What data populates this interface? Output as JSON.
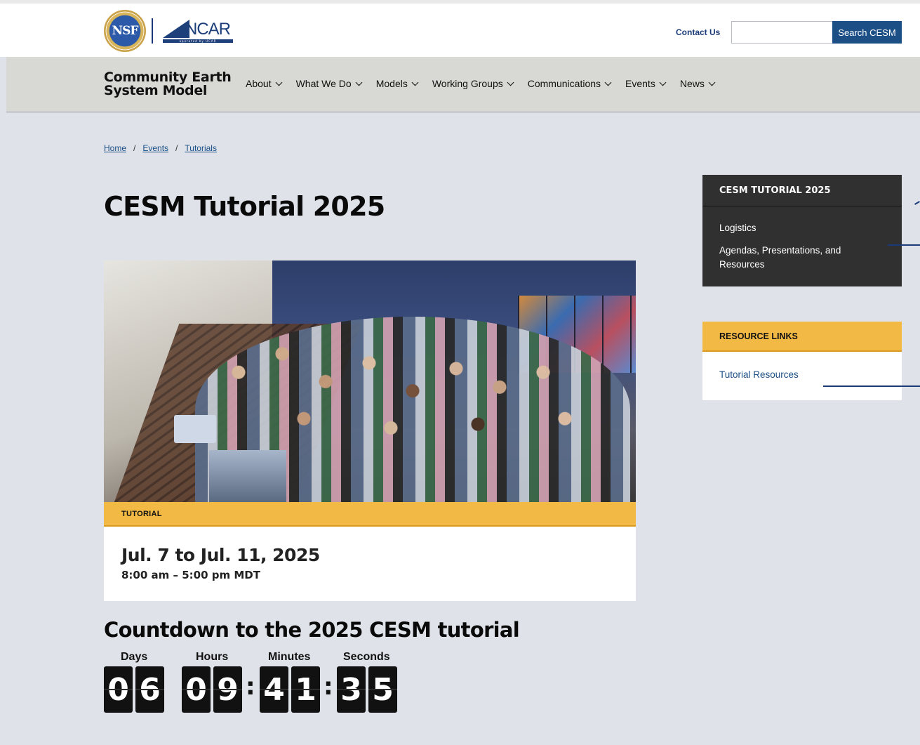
{
  "header": {
    "logo_nsf": "NSF",
    "logo_ncar": "NCAR",
    "logo_ncar_sub": "operated by UCAR",
    "contact_label": "Contact Us",
    "search_placeholder": "",
    "search_button": "Search CESM"
  },
  "nav": {
    "site_title_line1": "Community Earth",
    "site_title_line2": "System Model",
    "items": [
      {
        "label": "About"
      },
      {
        "label": "What We Do"
      },
      {
        "label": "Models"
      },
      {
        "label": "Working Groups"
      },
      {
        "label": "Communications"
      },
      {
        "label": "Events"
      },
      {
        "label": "News"
      }
    ]
  },
  "breadcrumb": {
    "items": [
      "Home",
      "Events",
      "Tutorials"
    ],
    "separator": "/"
  },
  "page": {
    "title": "CESM Tutorial 2025"
  },
  "event": {
    "tag": "TUTORIAL",
    "date": "Jul. 7 to Jul. 11, 2025",
    "time": "8:00 am – 5:00 pm MDT"
  },
  "countdown": {
    "title": "Countdown to the 2025 CESM tutorial",
    "labels": [
      "Days",
      "Hours",
      "Minutes",
      "Seconds"
    ],
    "days": [
      "0",
      "6"
    ],
    "hours": [
      "0",
      "9"
    ],
    "minutes": [
      "4",
      "1"
    ],
    "seconds": [
      "3",
      "5"
    ]
  },
  "sidebar": {
    "tutorial_heading": "CESM TUTORIAL 2025",
    "tutorial_links": [
      "Logistics",
      "Agendas, Presentations, and Resources"
    ],
    "resources_heading": "RESOURCE LINKS",
    "resource_links": [
      "Tutorial Resources"
    ]
  },
  "colors": {
    "accent_gold": "#f3b945",
    "brand_blue": "#1b4f86",
    "dark_panel": "#303030"
  }
}
